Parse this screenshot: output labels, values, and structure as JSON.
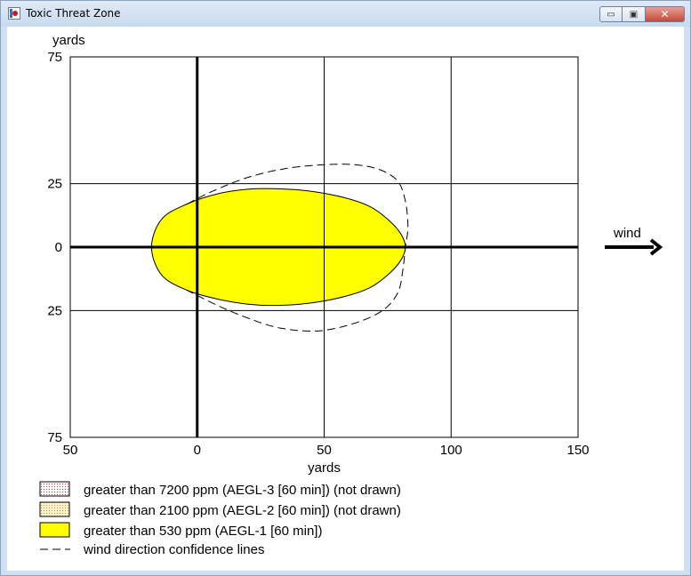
{
  "window": {
    "title": "Toxic Threat Zone",
    "controls": {
      "minimize_glyph": "▭",
      "maximize_glyph": "▣",
      "close_glyph": "✕"
    }
  },
  "chart_data": {
    "type": "area",
    "xlabel": "yards",
    "ylabel": "yards",
    "xlim": [
      -50,
      150
    ],
    "ylim": [
      -75,
      75
    ],
    "x_tick_labels": [
      "50",
      "0",
      "50",
      "100",
      "150"
    ],
    "x_tick_values": [
      -50,
      0,
      50,
      100,
      150
    ],
    "y_tick_labels": [
      "75",
      "25",
      "0",
      "25",
      "75"
    ],
    "y_tick_values": [
      75,
      25,
      0,
      -25,
      -75
    ],
    "grid": true,
    "wind_label": "wind",
    "colors": {
      "aegl1": "#ffff00",
      "confidence_line": "#000000"
    },
    "series": [
      {
        "name": "greater than 530 ppm (AEGL-1 [60 min])",
        "kind": "filled-zone",
        "points": [
          [
            -18,
            0
          ],
          [
            -14,
            11
          ],
          [
            -4,
            17
          ],
          [
            8,
            21
          ],
          [
            20,
            22.8
          ],
          [
            32,
            23
          ],
          [
            45,
            22
          ],
          [
            58,
            19.5
          ],
          [
            68,
            16
          ],
          [
            75,
            11
          ],
          [
            80,
            5.5
          ],
          [
            82,
            0
          ],
          [
            80,
            -5.5
          ],
          [
            75,
            -11
          ],
          [
            68,
            -16
          ],
          [
            58,
            -19.5
          ],
          [
            45,
            -22
          ],
          [
            32,
            -23
          ],
          [
            20,
            -22.5
          ],
          [
            8,
            -20.5
          ],
          [
            -4,
            -17
          ],
          [
            -14,
            -11
          ]
        ]
      },
      {
        "name": "wind direction confidence lines",
        "kind": "dashed-line",
        "points": [
          [
            -4,
            17
          ],
          [
            6,
            22
          ],
          [
            20,
            27.5
          ],
          [
            35,
            31
          ],
          [
            50,
            32.5
          ],
          [
            62,
            32.5
          ],
          [
            72,
            30.5
          ],
          [
            79,
            26
          ],
          [
            82,
            18
          ],
          [
            83,
            8
          ],
          [
            82,
            0
          ],
          [
            81,
            -9
          ],
          [
            79,
            -18
          ],
          [
            73,
            -25
          ],
          [
            62,
            -30
          ],
          [
            48,
            -33
          ],
          [
            33,
            -32
          ],
          [
            20,
            -28
          ],
          [
            8,
            -23
          ],
          [
            -4,
            -17
          ]
        ]
      }
    ]
  },
  "legend": [
    {
      "label": "greater than 7200 ppm (AEGL-3 [60 min]) (not drawn)",
      "swatch": "aegl3"
    },
    {
      "label": "greater than 2100 ppm (AEGL-2 [60 min]) (not drawn)",
      "swatch": "aegl2"
    },
    {
      "label": "greater than 530 ppm (AEGL-1 [60 min])",
      "swatch": "aegl1"
    },
    {
      "label": "wind direction confidence lines",
      "swatch": "dashed"
    }
  ]
}
